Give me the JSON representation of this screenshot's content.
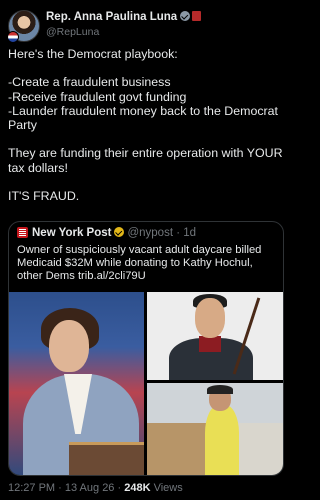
{
  "author": {
    "name": "Rep. Anna Paulina Luna",
    "handle": "@RepLuna"
  },
  "tweet_text": "Here's the Democrat playbook:\n\n-Create a fraudulent business\n-Receive fraudulent govt funding\n-Launder fraudulent money back to the Democrat Party\n\nThey are funding their entire operation with YOUR tax dollars!\n\nIT'S FRAUD.",
  "quote": {
    "name": "New York Post",
    "handle": "@nypost",
    "separator": "·",
    "age": "1d",
    "text": "Owner of suspiciously vacant adult daycare billed Medicaid $32M while donating to Kathy Hochul, other Dems ",
    "link": "trib.al/2cli79U"
  },
  "footer": {
    "time": "12:27 PM",
    "date": "13 Aug 26",
    "views_count": "248K",
    "views_label": "Views"
  },
  "colors": {
    "background": "#000000",
    "text": "#e7e9ea",
    "muted": "#71767b",
    "border": "#2f3336"
  }
}
